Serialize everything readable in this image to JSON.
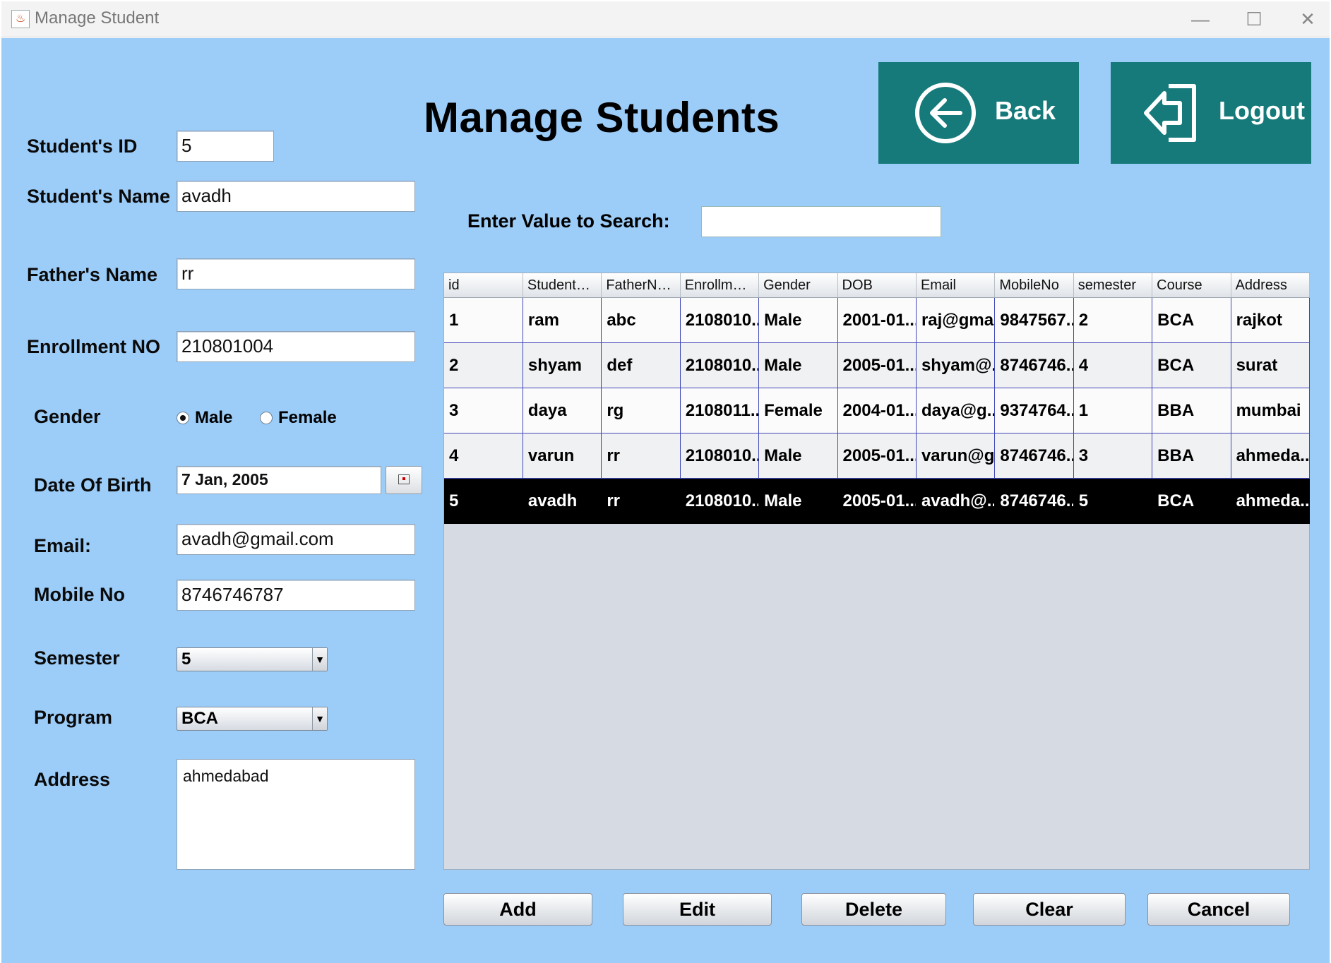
{
  "window": {
    "title": "Manage Student",
    "minimize": "—",
    "maximize": "☐",
    "close": "✕"
  },
  "page_title": "Manage Students",
  "form": {
    "student_id": {
      "label": "Student's ID",
      "value": "5"
    },
    "student_name": {
      "label": "Student's Name",
      "value": "avadh"
    },
    "father_name": {
      "label": "Father's Name",
      "value": "rr"
    },
    "enrollment": {
      "label": "Enrollment NO",
      "value": "210801004"
    },
    "gender": {
      "label": "Gender",
      "options": [
        "Male",
        "Female"
      ],
      "selected": "Male"
    },
    "dob": {
      "label": "Date Of Birth",
      "value": "7 Jan, 2005"
    },
    "email": {
      "label": "Email:",
      "value": "avadh@gmail.com"
    },
    "mobile": {
      "label": "Mobile No",
      "value": "8746746787"
    },
    "semester": {
      "label": "Semester",
      "value": "5"
    },
    "program": {
      "label": "Program",
      "value": "BCA"
    },
    "address": {
      "label": "Address",
      "value": "ahmedabad"
    }
  },
  "nav_buttons": {
    "back": "Back",
    "logout": "Logout"
  },
  "search": {
    "label": "Enter Value to Search:",
    "value": ""
  },
  "table": {
    "columns": [
      "id",
      "StudentNa...",
      "FatherName",
      "Enrollment...",
      "Gender",
      "DOB",
      "Email",
      "MobileNo",
      "semester",
      "Course",
      "Address"
    ],
    "rows": [
      [
        "1",
        "ram",
        "abc",
        "2108010...",
        "Male",
        "2001-01...",
        "raj@gma...",
        "9847567...",
        "2",
        "BCA",
        "rajkot"
      ],
      [
        "2",
        "shyam",
        "def",
        "2108010...",
        "Male",
        "2005-01...",
        "shyam@...",
        "8746746...",
        "4",
        "BCA",
        "surat"
      ],
      [
        "3",
        "daya",
        "rg",
        "2108011...",
        "Female",
        "2004-01...",
        "daya@g...",
        "9374764...",
        "1",
        "BBA",
        "mumbai"
      ],
      [
        "4",
        "varun",
        "rr",
        "2108010...",
        "Male",
        "2005-01...",
        "varun@g...",
        "8746746...",
        "3",
        "BBA",
        "ahmeda..."
      ],
      [
        "5",
        "avadh",
        "rr",
        "2108010...",
        "Male",
        "2005-01...",
        "avadh@...",
        "8746746...",
        "5",
        "BCA",
        "ahmeda..."
      ]
    ],
    "selected_row": 5
  },
  "actions": {
    "add": "Add",
    "edit": "Edit",
    "delete": "Delete",
    "clear": "Clear",
    "cancel": "Cancel"
  },
  "colors": {
    "background": "#9cccf8",
    "nav_button": "#167a7a",
    "selection": "#000000"
  }
}
